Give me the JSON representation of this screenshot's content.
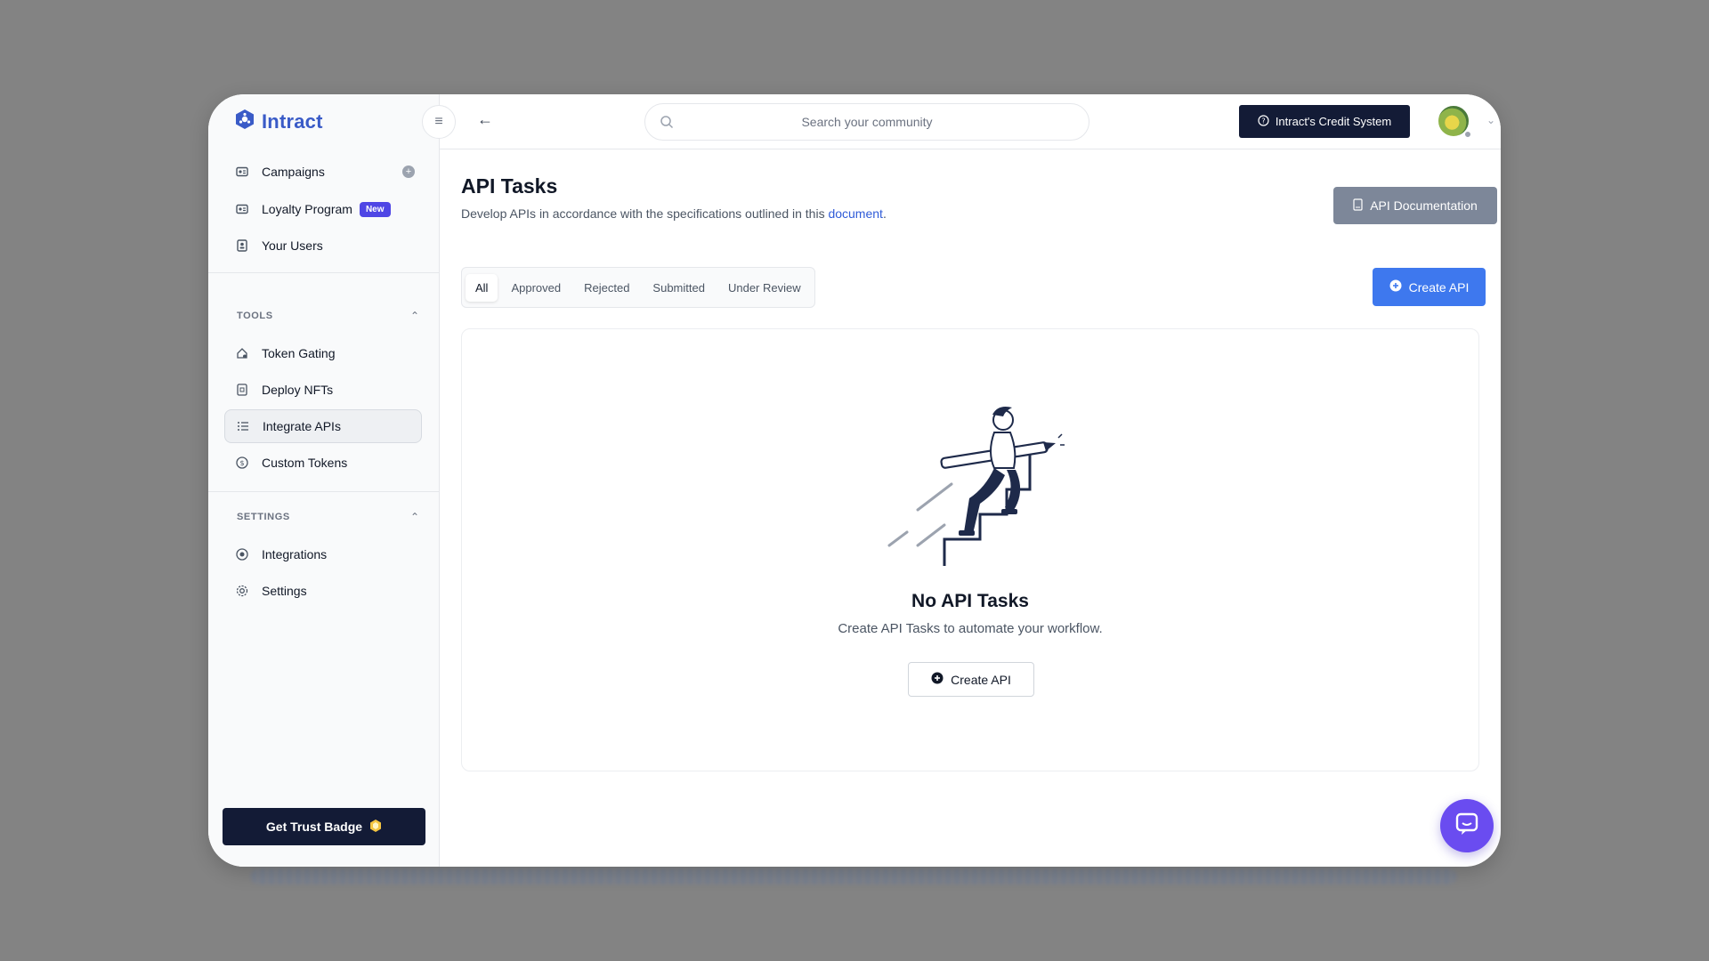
{
  "app": {
    "brand": "Intract"
  },
  "sidebar": {
    "items": [
      {
        "label": "Campaigns",
        "icon": "campaign-icon"
      },
      {
        "label": "Loyalty Program",
        "icon": "loyalty-icon",
        "badge": "New"
      },
      {
        "label": "Your Users",
        "icon": "users-icon"
      }
    ],
    "tools_label": "TOOLS",
    "tools": [
      {
        "label": "Token Gating",
        "icon": "token-gating-icon"
      },
      {
        "label": "Deploy NFTs",
        "icon": "nft-icon"
      },
      {
        "label": "Integrate APIs",
        "icon": "list-icon",
        "active": true
      },
      {
        "label": "Custom Tokens",
        "icon": "coin-icon"
      }
    ],
    "settings_label": "SETTINGS",
    "settings": [
      {
        "label": "Integrations",
        "icon": "integrations-icon"
      },
      {
        "label": "Settings",
        "icon": "gear-icon"
      }
    ],
    "trust_badge_label": "Get Trust Badge"
  },
  "header": {
    "search_placeholder": "Search your community",
    "credit_label": "Intract's Credit System"
  },
  "main": {
    "title": "API Tasks",
    "description_prefix": "Develop APIs in accordance with the specifications outlined in this ",
    "description_link": "document",
    "description_suffix": ".",
    "doc_button": "API Documentation",
    "tabs": [
      "All",
      "Approved",
      "Rejected",
      "Submitted",
      "Under Review"
    ],
    "active_tab": "All",
    "create_button": "Create API",
    "empty": {
      "title": "No API Tasks",
      "description": "Create API Tasks to automate your workflow.",
      "button": "Create API"
    }
  },
  "colors": {
    "brand": "#3a5bc7",
    "dark_button": "#131b36",
    "primary_blue": "#3e78ee",
    "new_badge": "#4f46e5",
    "chat_fab": "#6a4cf0",
    "doc_button": "#7d8799"
  }
}
